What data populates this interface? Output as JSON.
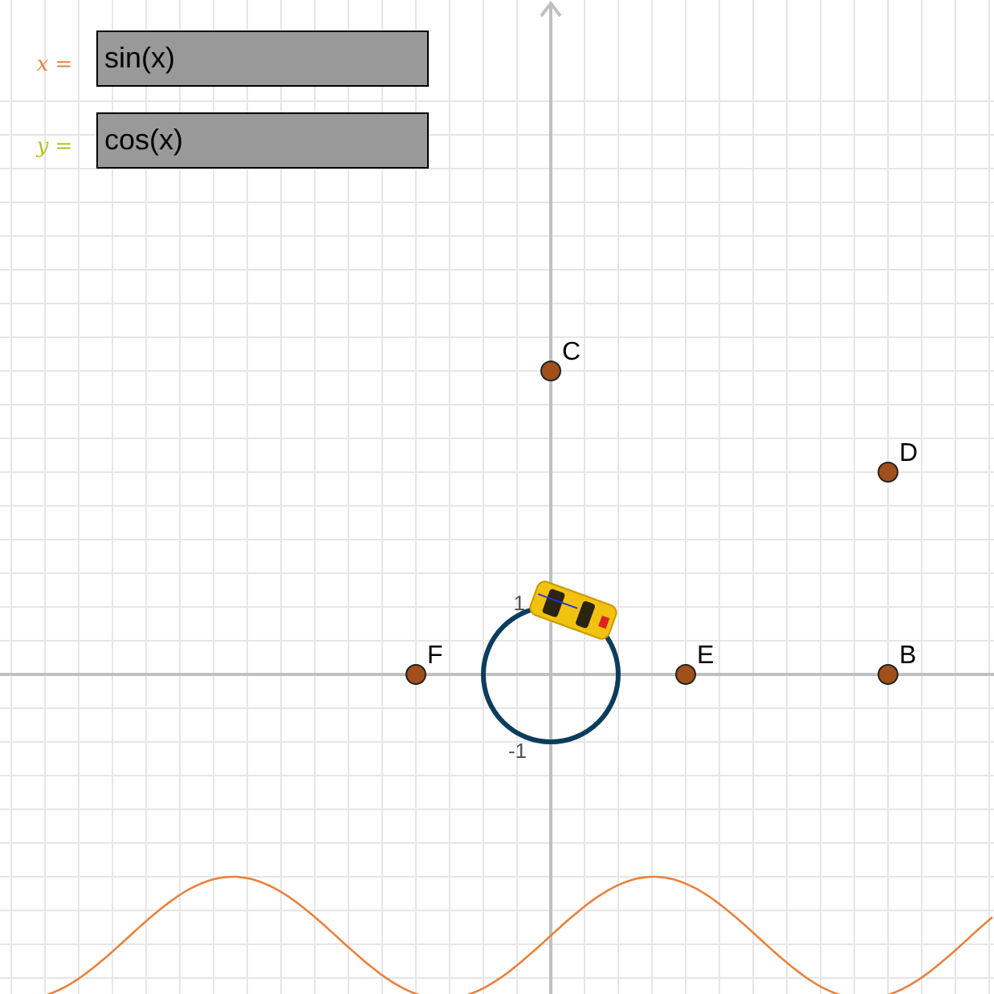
{
  "inputs": [
    {
      "label": "x =",
      "value": "sin(x)",
      "color": "#e8823c"
    },
    {
      "label": "y =",
      "value": "cos(x)",
      "color": "#b5c21e"
    }
  ],
  "axis_labels": [
    "1",
    "-1"
  ],
  "points": [
    {
      "label": "C"
    },
    {
      "label": "D"
    },
    {
      "label": "F"
    },
    {
      "label": "E"
    },
    {
      "label": "B"
    }
  ]
}
